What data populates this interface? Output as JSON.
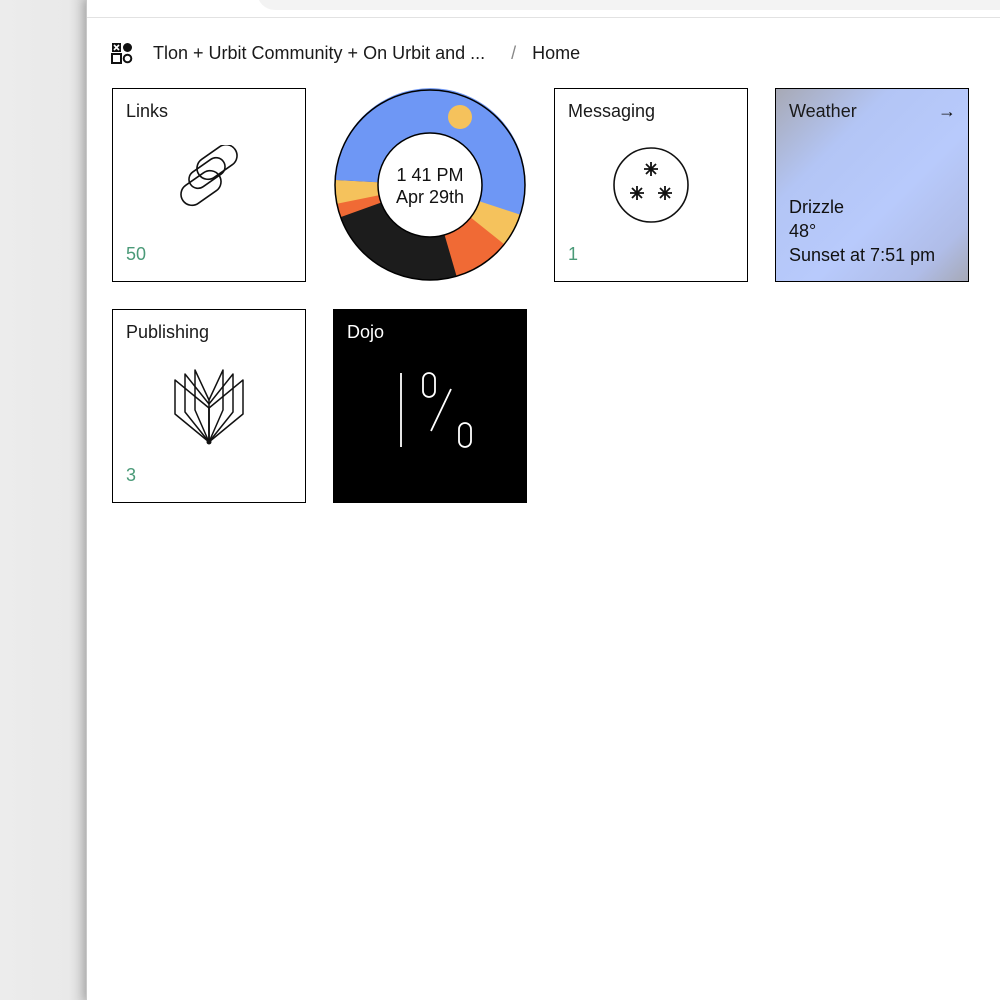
{
  "breadcrumb": {
    "group_name": "Tlon + Urbit Community + On Urbit and ...",
    "separator": "/",
    "current": "Home"
  },
  "tiles": {
    "links": {
      "title": "Links",
      "count": "50",
      "icon": "chain-link-icon"
    },
    "clock": {
      "time": "1 41 PM",
      "date": "Apr 29th"
    },
    "messaging": {
      "title": "Messaging",
      "count": "1",
      "icon": "asterisks-circle-icon"
    },
    "weather": {
      "title": "Weather",
      "arrow": "→",
      "condition": "Drizzle",
      "temperature": "48°",
      "sunset": "Sunset at 7:51 pm"
    },
    "publishing": {
      "title": "Publishing",
      "count": "3",
      "icon": "open-book-icon"
    },
    "dojo": {
      "title": "Dojo",
      "icon": "dojo-percent-icon"
    }
  },
  "colors": {
    "count_green": "#4a9a78",
    "clock_day": "#6e97f5",
    "clock_sun": "#f5c25c",
    "clock_dusk": "#f06a35",
    "clock_night": "#1c1c1c"
  }
}
